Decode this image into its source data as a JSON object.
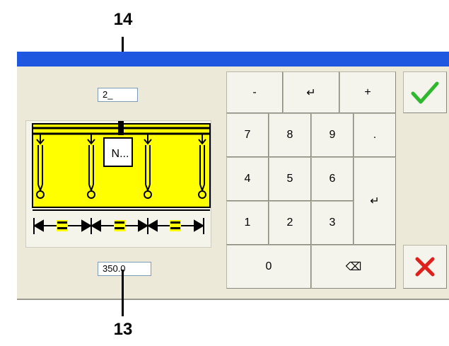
{
  "callouts": {
    "top": "14",
    "bottom": "13"
  },
  "fields": {
    "count_value": "2_",
    "length_value": "350.0"
  },
  "diagram": {
    "button_label": "N..."
  },
  "keypad": {
    "minus": "-",
    "enter_top": "↵",
    "plus": "+",
    "k7": "7",
    "k8": "8",
    "k9": "9",
    "dot": ".",
    "k4": "4",
    "k5": "5",
    "k6": "6",
    "enter_right": "↵",
    "k1": "1",
    "k2": "2",
    "k3": "3",
    "k0": "0",
    "backspace": "⌫"
  },
  "colors": {
    "titlebar": "#1f57e0",
    "panel": "#ece9d8",
    "diagram_fill": "#ffff00",
    "confirm": "#2db82d",
    "cancel": "#e0201b"
  }
}
